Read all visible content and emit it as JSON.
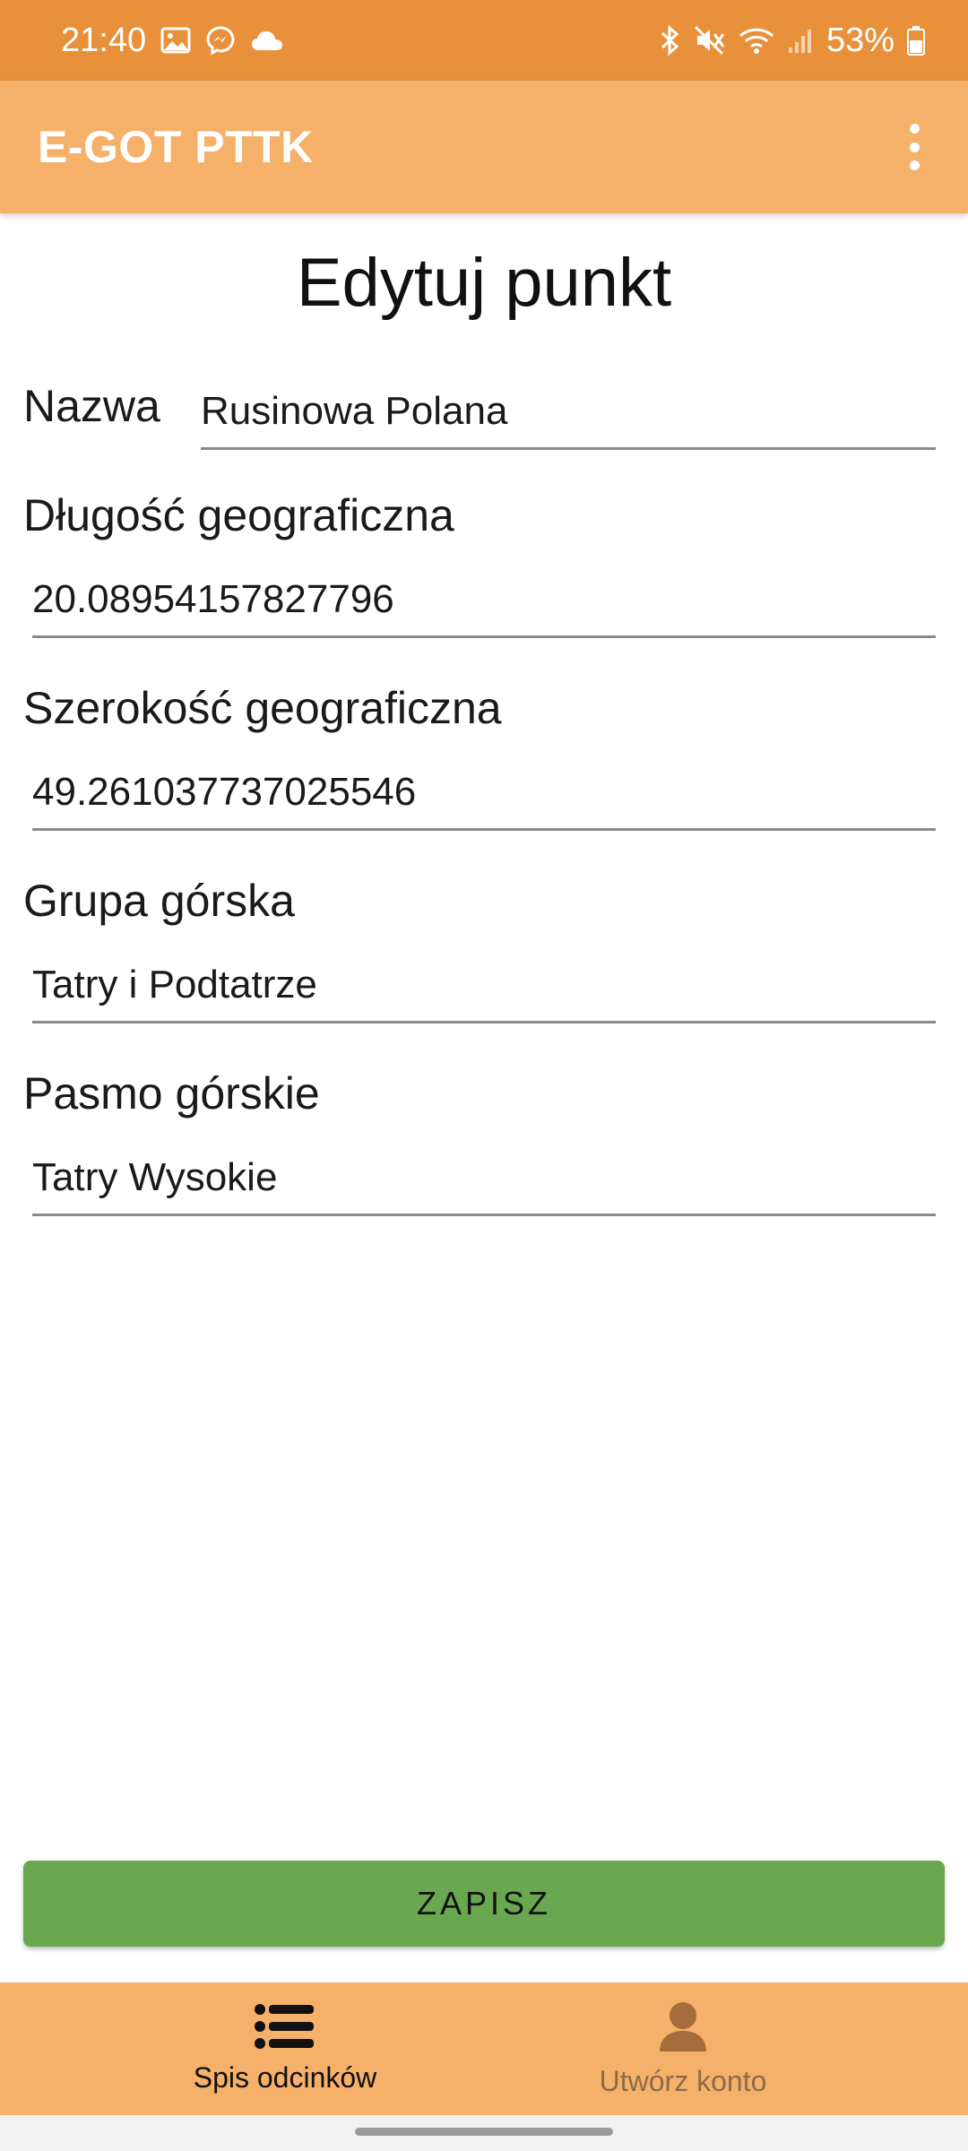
{
  "status_bar": {
    "time": "21:40",
    "left_icons": [
      "image-icon",
      "messenger-icon",
      "cloud-icon"
    ],
    "right_icons": [
      "bluetooth-icon",
      "mute-icon",
      "wifi-icon",
      "signal-icon",
      "battery-icon"
    ],
    "battery_text": "53%"
  },
  "app_bar": {
    "title": "E-GOT PTTK",
    "menu_icon": "more-vert-icon"
  },
  "page": {
    "title": "Edytuj punkt"
  },
  "form": {
    "name": {
      "label": "Nazwa",
      "value": "Rusinowa Polana"
    },
    "longitude": {
      "label": "Długość geograficzna",
      "value": "20.08954157827796"
    },
    "latitude": {
      "label": "Szerokość geograficzna",
      "value": "49.261037737025546"
    },
    "mountain_group": {
      "label": "Grupa górska",
      "value": "Tatry i Podtatrze"
    },
    "mountain_range": {
      "label": "Pasmo górskie",
      "value": "Tatry Wysokie"
    }
  },
  "save_button": {
    "label": "ZAPISZ"
  },
  "bottom_nav": {
    "items": [
      {
        "label": "Spis odcinków",
        "icon": "list-icon",
        "active": true
      },
      {
        "label": "Utwórz konto",
        "icon": "person-icon",
        "active": false
      }
    ]
  },
  "colors": {
    "status_bar": "#e8913a",
    "app_bar": "#f5b06a",
    "save_button": "#6aa84f",
    "inactive_nav": "#8c6a48"
  }
}
